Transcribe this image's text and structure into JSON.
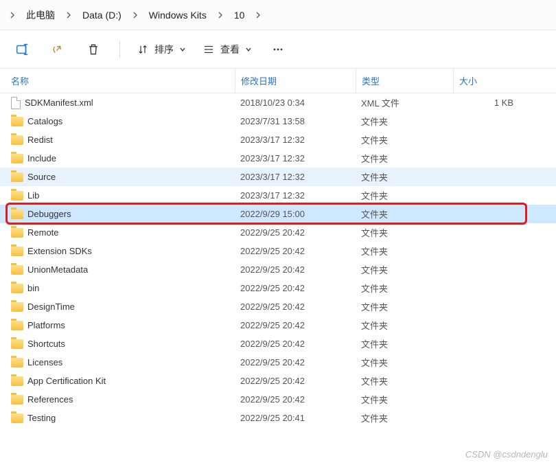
{
  "breadcrumb": [
    {
      "label": "此电脑"
    },
    {
      "label": "Data (D:)"
    },
    {
      "label": "Windows Kits"
    },
    {
      "label": "10"
    }
  ],
  "toolbar": {
    "sort_label": "排序",
    "view_label": "查看"
  },
  "columns": {
    "name": "名称",
    "date": "修改日期",
    "type": "类型",
    "size": "大小"
  },
  "rows": [
    {
      "name": "SDKManifest.xml",
      "date": "2018/10/23 0:34",
      "type": "XML 文件",
      "size": "1 KB",
      "icon": "file"
    },
    {
      "name": "Catalogs",
      "date": "2023/7/31 13:58",
      "type": "文件夹",
      "size": "",
      "icon": "folder"
    },
    {
      "name": "Redist",
      "date": "2023/3/17 12:32",
      "type": "文件夹",
      "size": "",
      "icon": "folder"
    },
    {
      "name": "Include",
      "date": "2023/3/17 12:32",
      "type": "文件夹",
      "size": "",
      "icon": "folder"
    },
    {
      "name": "Source",
      "date": "2023/3/17 12:32",
      "type": "文件夹",
      "size": "",
      "icon": "folder",
      "state": "hover"
    },
    {
      "name": "Lib",
      "date": "2023/3/17 12:32",
      "type": "文件夹",
      "size": "",
      "icon": "folder"
    },
    {
      "name": "Debuggers",
      "date": "2022/9/29 15:00",
      "type": "文件夹",
      "size": "",
      "icon": "folder",
      "state": "highlighted"
    },
    {
      "name": "Remote",
      "date": "2022/9/25 20:42",
      "type": "文件夹",
      "size": "",
      "icon": "folder"
    },
    {
      "name": "Extension SDKs",
      "date": "2022/9/25 20:42",
      "type": "文件夹",
      "size": "",
      "icon": "folder"
    },
    {
      "name": "UnionMetadata",
      "date": "2022/9/25 20:42",
      "type": "文件夹",
      "size": "",
      "icon": "folder"
    },
    {
      "name": "bin",
      "date": "2022/9/25 20:42",
      "type": "文件夹",
      "size": "",
      "icon": "folder"
    },
    {
      "name": "DesignTime",
      "date": "2022/9/25 20:42",
      "type": "文件夹",
      "size": "",
      "icon": "folder"
    },
    {
      "name": "Platforms",
      "date": "2022/9/25 20:42",
      "type": "文件夹",
      "size": "",
      "icon": "folder"
    },
    {
      "name": "Shortcuts",
      "date": "2022/9/25 20:42",
      "type": "文件夹",
      "size": "",
      "icon": "folder"
    },
    {
      "name": "Licenses",
      "date": "2022/9/25 20:42",
      "type": "文件夹",
      "size": "",
      "icon": "folder"
    },
    {
      "name": "App Certification Kit",
      "date": "2022/9/25 20:42",
      "type": "文件夹",
      "size": "",
      "icon": "folder"
    },
    {
      "name": "References",
      "date": "2022/9/25 20:42",
      "type": "文件夹",
      "size": "",
      "icon": "folder"
    },
    {
      "name": "Testing",
      "date": "2022/9/25 20:41",
      "type": "文件夹",
      "size": "",
      "icon": "folder"
    }
  ],
  "watermark": "CSDN @csdndenglu"
}
